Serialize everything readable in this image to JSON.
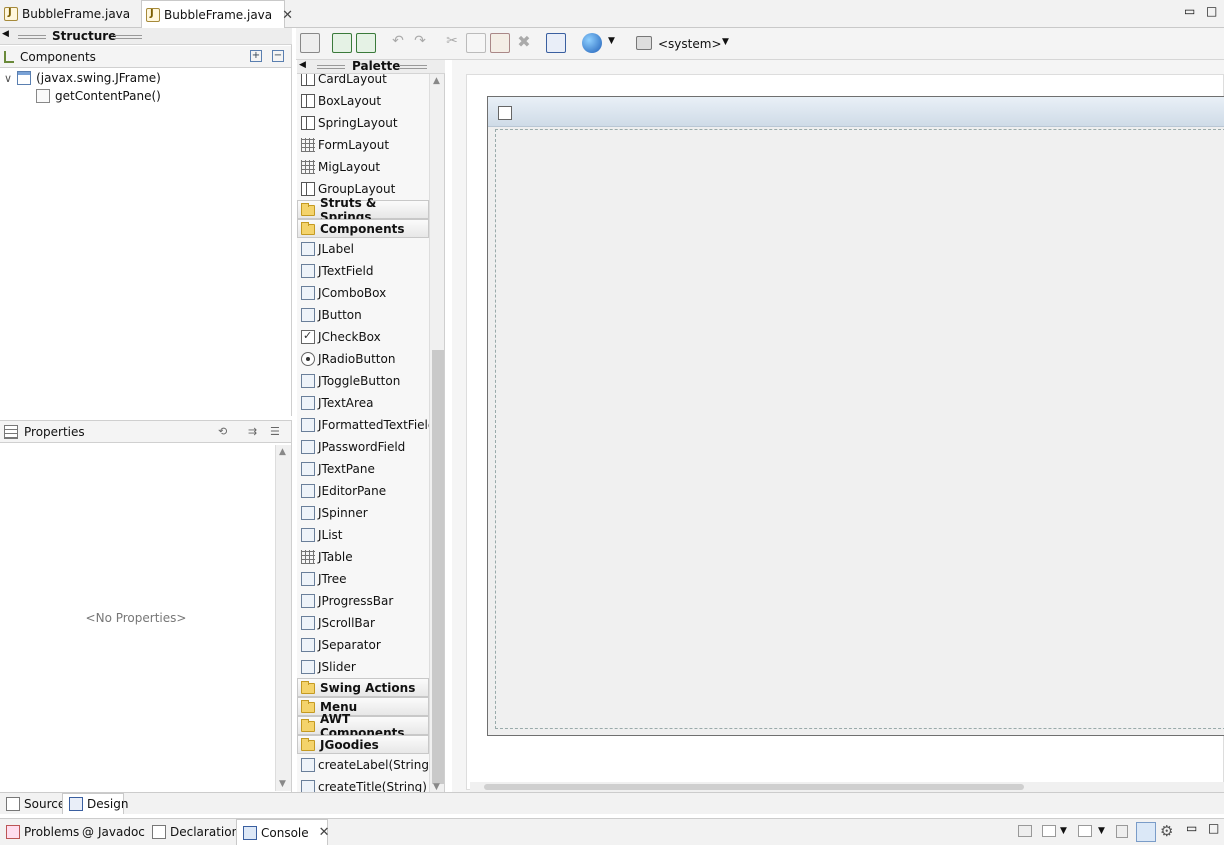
{
  "editor_tabs": [
    {
      "label": "BubbleFrame.java",
      "active": false
    },
    {
      "label": "BubbleFrame.java",
      "active": true
    }
  ],
  "structure": {
    "title": "Structure",
    "components_label": "Components",
    "tree": [
      {
        "label": "(javax.swing.JFrame)",
        "icon": "frame-icon"
      },
      {
        "label": "getContentPane()",
        "icon": "component-icon"
      }
    ]
  },
  "properties": {
    "title": "Properties",
    "empty_text": "<No Properties>"
  },
  "palette": {
    "title": "Palette",
    "items": [
      {
        "label": "CardLayout",
        "kind": "layout"
      },
      {
        "label": "BoxLayout",
        "kind": "layout"
      },
      {
        "label": "SpringLayout",
        "kind": "layout"
      },
      {
        "label": "FormLayout",
        "kind": "grid"
      },
      {
        "label": "MigLayout",
        "kind": "grid"
      },
      {
        "label": "GroupLayout",
        "kind": "layout"
      },
      {
        "label": "Struts & Springs",
        "kind": "category"
      },
      {
        "label": "Components",
        "kind": "category-open"
      },
      {
        "label": "JLabel",
        "kind": "widget"
      },
      {
        "label": "JTextField",
        "kind": "widget"
      },
      {
        "label": "JComboBox",
        "kind": "widget"
      },
      {
        "label": "JButton",
        "kind": "widget"
      },
      {
        "label": "JCheckBox",
        "kind": "check"
      },
      {
        "label": "JRadioButton",
        "kind": "radio"
      },
      {
        "label": "JToggleButton",
        "kind": "widget"
      },
      {
        "label": "JTextArea",
        "kind": "widget"
      },
      {
        "label": "JFormattedTextField",
        "kind": "widget"
      },
      {
        "label": "JPasswordField",
        "kind": "widget"
      },
      {
        "label": "JTextPane",
        "kind": "widget"
      },
      {
        "label": "JEditorPane",
        "kind": "widget"
      },
      {
        "label": "JSpinner",
        "kind": "widget"
      },
      {
        "label": "JList",
        "kind": "widget"
      },
      {
        "label": "JTable",
        "kind": "grid"
      },
      {
        "label": "JTree",
        "kind": "widget"
      },
      {
        "label": "JProgressBar",
        "kind": "widget"
      },
      {
        "label": "JScrollBar",
        "kind": "widget"
      },
      {
        "label": "JSeparator",
        "kind": "widget"
      },
      {
        "label": "JSlider",
        "kind": "widget"
      },
      {
        "label": "Swing Actions",
        "kind": "category"
      },
      {
        "label": "Menu",
        "kind": "category"
      },
      {
        "label": "AWT Components",
        "kind": "category"
      },
      {
        "label": "JGoodies",
        "kind": "category-open"
      },
      {
        "label": "createLabel(String)",
        "kind": "widget"
      },
      {
        "label": "createTitle(String)",
        "kind": "widget"
      }
    ]
  },
  "toolbar": {
    "look_and_feel": "<system>"
  },
  "view_tabs": [
    {
      "label": "Source",
      "active": false
    },
    {
      "label": "Design",
      "active": true
    }
  ],
  "bottom_tabs": [
    {
      "label": "Problems",
      "icon": "problems-icon"
    },
    {
      "label": "Javadoc",
      "icon": "javadoc-icon"
    },
    {
      "label": "Declaration",
      "icon": "declaration-icon"
    },
    {
      "label": "Console",
      "icon": "console-icon",
      "active": true
    }
  ]
}
